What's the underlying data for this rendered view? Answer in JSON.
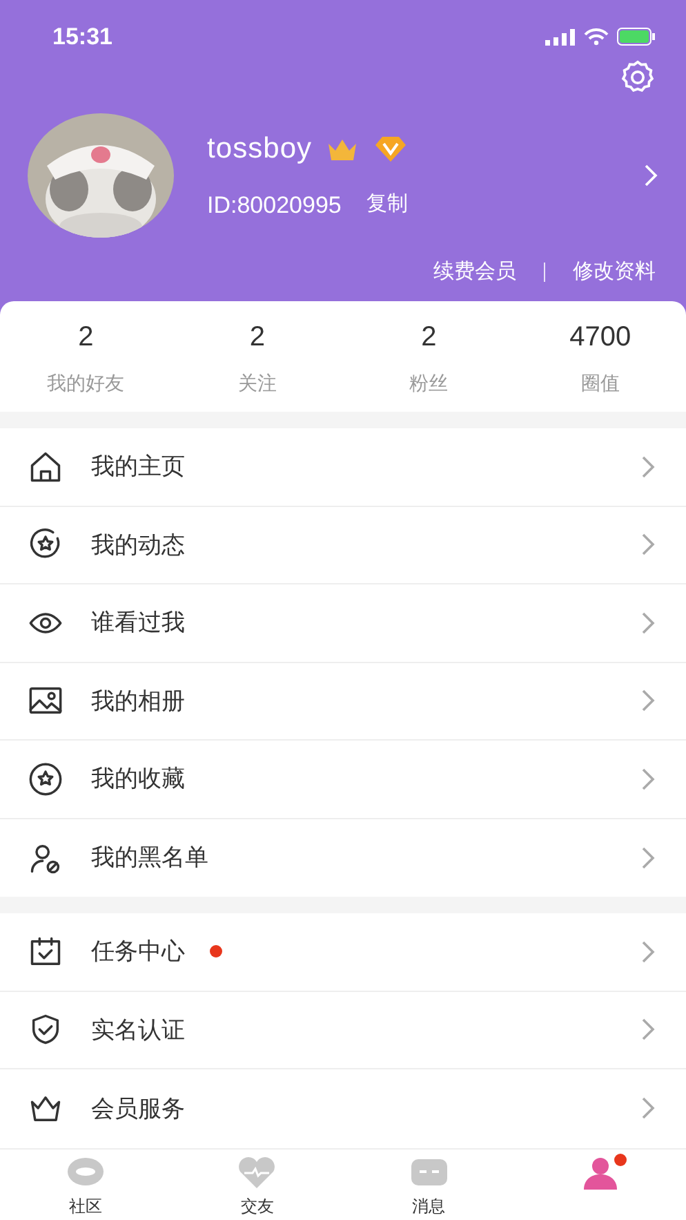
{
  "status_bar": {
    "time": "15:31"
  },
  "profile": {
    "name": "tossboy",
    "id": "ID:80020995",
    "copy": "复制",
    "links": [
      "续费会员",
      "修改资料"
    ]
  },
  "stats": [
    {
      "value": "2",
      "label": "我的好友"
    },
    {
      "value": "2",
      "label": "关注"
    },
    {
      "value": "2",
      "label": "粉丝"
    },
    {
      "value": "4700",
      "label": "圈值"
    }
  ],
  "menu_groups": [
    [
      {
        "label": "我的主页",
        "badge": false
      },
      {
        "label": "我的动态",
        "badge": false
      },
      {
        "label": "谁看过我",
        "badge": false
      },
      {
        "label": "我的相册",
        "badge": false
      },
      {
        "label": "我的收藏",
        "badge": false
      },
      {
        "label": "我的黑名单",
        "badge": false
      }
    ],
    [
      {
        "label": "任务中心",
        "badge": true
      },
      {
        "label": "实名认证",
        "badge": false
      },
      {
        "label": "会员服务",
        "badge": false
      }
    ]
  ],
  "tab_bar": [
    {
      "label": "社区",
      "selected": false,
      "badge": false
    },
    {
      "label": "交友",
      "selected": false,
      "badge": false
    },
    {
      "label": "消息",
      "selected": false,
      "badge": false
    },
    {
      "selected": true,
      "badge": true
    }
  ]
}
